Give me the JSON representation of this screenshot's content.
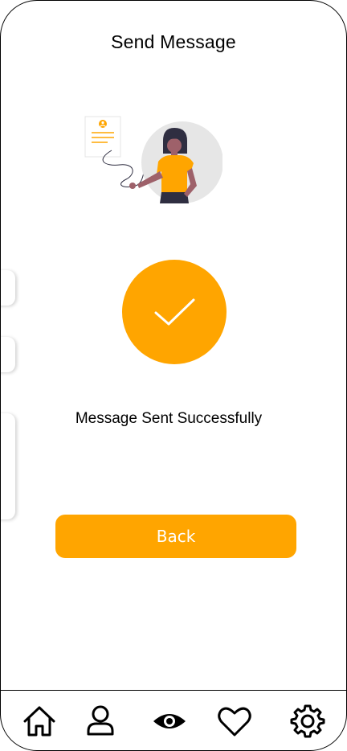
{
  "header": {
    "title": "Send Message"
  },
  "status": {
    "message": "Message Sent Successfully"
  },
  "actions": {
    "back_label": "Back"
  },
  "colors": {
    "accent": "#FFA500",
    "text": "#000000",
    "background": "#FFFFFF"
  },
  "nav": {
    "items": [
      {
        "icon": "home-icon"
      },
      {
        "icon": "user-icon"
      },
      {
        "icon": "eye-icon",
        "active": true
      },
      {
        "icon": "heart-icon"
      },
      {
        "icon": "gear-icon"
      }
    ]
  }
}
